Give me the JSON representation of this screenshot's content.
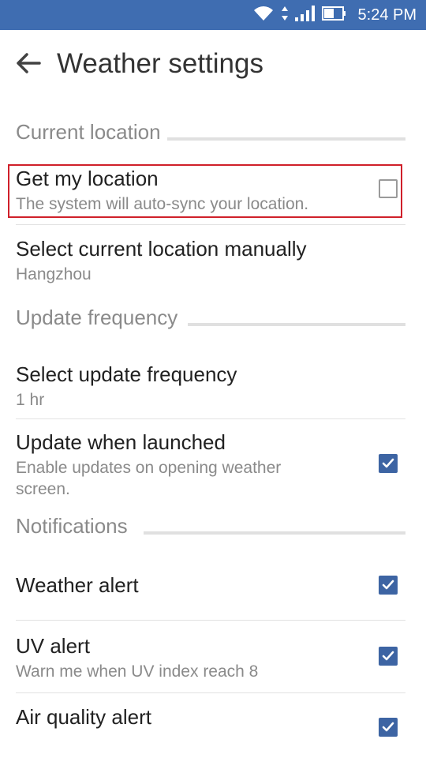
{
  "status_bar": {
    "time": "5:24 PM",
    "background_color": "#3f6db1",
    "icons": [
      "wifi-icon",
      "data-arrows-icon",
      "signal-icon",
      "battery-icon"
    ]
  },
  "toolbar": {
    "back_icon": "arrow-back-icon",
    "title": "Weather settings"
  },
  "sections": [
    {
      "header": "Current location",
      "items": [
        {
          "title": "Get my location",
          "summary": "The system will auto-sync your location.",
          "checked": false
        },
        {
          "title": "Select current location manually",
          "summary": "Hangzhou"
        }
      ]
    },
    {
      "header": "Update frequency",
      "items": [
        {
          "title": "Select update frequency",
          "summary": "1 hr"
        },
        {
          "title": "Update when launched",
          "summary": "Enable updates on opening weather screen.",
          "checked": true
        }
      ]
    },
    {
      "header": "Notifications",
      "items": [
        {
          "title": "Weather alert",
          "checked": true
        },
        {
          "title": "UV alert",
          "summary": "Warn me when UV index reach 8",
          "checked": true
        },
        {
          "title": "Air quality alert",
          "checked": true
        }
      ]
    }
  ],
  "colors": {
    "accent": "#3d64a3",
    "highlight": "#d0202a"
  }
}
